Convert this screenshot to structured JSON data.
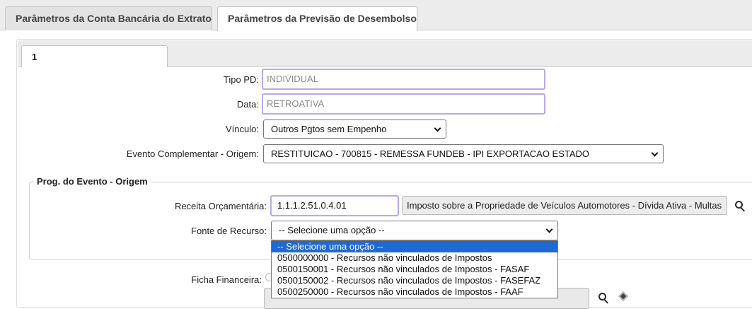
{
  "outer_tabs": [
    {
      "label": "Parâmetros da Conta Bancária do Extrato",
      "active": false
    },
    {
      "label": "Parâmetros da Previsão de Desembolso",
      "active": true
    }
  ],
  "inner_tab": {
    "label": "1"
  },
  "form": {
    "tipo_pd": {
      "label": "Tipo PD:",
      "value": "INDIVIDUAL"
    },
    "data": {
      "label": "Data:",
      "value": "RETROATIVA"
    },
    "vinculo": {
      "label": "Vínculo:",
      "selected": "Outros Pgtos sem Empenho"
    },
    "evento_complementar": {
      "label": "Evento Complementar - Origem:",
      "selected": "RESTITUICAO - 700815 - REMESSA FUNDEB - IPI EXPORTACAO ESTADO"
    }
  },
  "prog_evento": {
    "legend": "Prog. do Evento - Origem",
    "receita": {
      "label": "Receita Orçamentária:",
      "value": "1.1.1.2.51.0.4.01",
      "description": "Imposto sobre a Propriedade de Veículos Automotores - Dívida Ativa - Multas"
    },
    "fonte": {
      "label": "Fonte de Recurso:",
      "selected": "-- Selecione uma opção --",
      "options": [
        "-- Selecione uma opção --",
        "0500000000 - Recursos não vinculados de Impostos",
        "0500150001 - Recursos não vinculados de Impostos - FASAF",
        "0500150002 - Recursos não vinculados de Impostos - FASEFAZ",
        "0500250000 - Recursos não vinculados de Impostos - FAAF"
      ],
      "highlighted_index": 0
    }
  },
  "ficha": {
    "label": "Ficha Financeira:"
  },
  "icons": {
    "search": "search-icon",
    "clear": "diamond-eraser-icon"
  },
  "colors": {
    "highlight": "#1e69d6",
    "focus_border": "#b9a9e6"
  }
}
